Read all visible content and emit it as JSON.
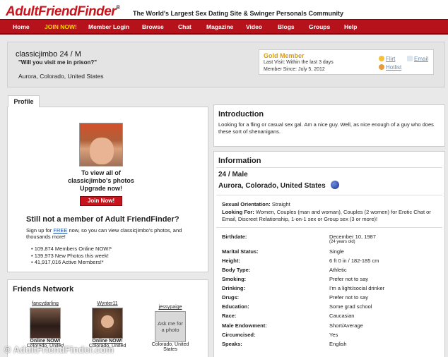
{
  "brand": {
    "logo": "AdultFriendFinder",
    "tm": "®",
    "tagline": "The World's Largest Sex Dating Site & Swinger Personals Community",
    "primary": "#b5121b"
  },
  "nav": [
    {
      "label": "Home"
    },
    {
      "label": "JOIN NOW!"
    },
    {
      "label": "Member Login"
    },
    {
      "label": "Browse"
    },
    {
      "label": "Chat"
    },
    {
      "label": "Magazine"
    },
    {
      "label": "Video"
    },
    {
      "label": "Blogs"
    },
    {
      "label": "Groups"
    },
    {
      "label": "Help"
    }
  ],
  "header": {
    "username": "classicjimbo 24 / M",
    "quote": "\"Will you visit me in prison?\"",
    "location": "Aurora, Colorado, United States"
  },
  "gold": {
    "title": "Gold Member",
    "last_visit": "Last Visit: Within the last 3 days",
    "since": "Member Since: July 5, 2012",
    "flirt": "Flirt",
    "email": "Email",
    "hotlist": "Hotlist"
  },
  "profile": {
    "tab": "Profile",
    "view1": "To view all of",
    "view2": "classicjimbo's photos",
    "view3": "Upgrade now!",
    "join_btn": "Join Now!",
    "not_member": "Still not a member of Adult FriendFinder?",
    "signup_pre": "Sign up for ",
    "signup_free": "FREE",
    "signup_post": " now, so you can view classicjimbo's photos, and thousands more!",
    "stats": [
      "109,874 Members Online NOW!*",
      "139,973 New Photos this week!",
      "41,917,016 Active Members!*"
    ]
  },
  "friends": {
    "title": "Friends Network",
    "items": [
      {
        "name": "fancydarling",
        "loc": "Colorado, United",
        "online": "Online NOW!",
        "placeholder": ""
      },
      {
        "name": "Wynter11",
        "loc": "Colorado, United",
        "online": "Online NOW!",
        "placeholder": ""
      },
      {
        "name": "jessypaige",
        "loc": "Colorado, United States",
        "online": "",
        "placeholder": "Ask me for a photo"
      }
    ]
  },
  "intro": {
    "title": "Introduction",
    "text": "Looking for a fling or casual sex gal. Am a nice guy. Well, as nice enough of a guy who does these sort of shenanigans."
  },
  "info": {
    "title": "Information",
    "agesex": "24 / Male",
    "location": "Aurora, Colorado, United States",
    "orientation_label": "Sexual Orientation:",
    "orientation": "Straight",
    "looking_label": "Looking For:",
    "looking": "Women, Couples (man and woman), Couples (2 women) for Erotic Chat or Email, Discreet Relationship, 1-on-1 sex or Group sex (3 or more)!",
    "rows": [
      {
        "k": "Birthdate:",
        "v": "December 10, 1987",
        "sub": "(24 years old)"
      },
      {
        "k": "Marital Status:",
        "v": "Single"
      },
      {
        "k": "Height:",
        "v": "6 ft 0 in / 182-185 cm"
      },
      {
        "k": "Body Type:",
        "v": "Athletic"
      },
      {
        "k": "Smoking:",
        "v": "Prefer not to say"
      },
      {
        "k": "Drinking:",
        "v": "I'm a light/social drinker"
      },
      {
        "k": "Drugs:",
        "v": "Prefer not to say"
      },
      {
        "k": "Education:",
        "v": "Some grad school"
      },
      {
        "k": "Race:",
        "v": "Caucasian"
      },
      {
        "k": "Male Endowment:",
        "v": "Short/Average"
      },
      {
        "k": "Circumcised:",
        "v": "Yes"
      },
      {
        "k": "Speaks:",
        "v": "English"
      }
    ]
  },
  "watermark": "© AdultFriendFinder.com"
}
